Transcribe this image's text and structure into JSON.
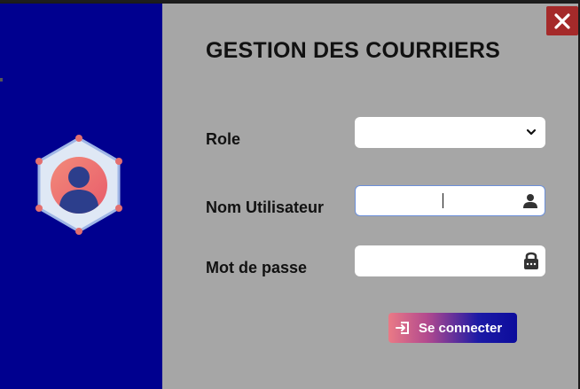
{
  "app": {
    "title": "GESTION DES COURRIERS"
  },
  "form": {
    "role_label": "Role",
    "role_value": "",
    "username_label": "Nom Utilisateur",
    "username_value": "",
    "password_label": "Mot de passe",
    "password_value": ""
  },
  "buttons": {
    "connect_label": "Se connecter"
  },
  "icons": {
    "close": "close-icon",
    "dropdown": "chevron-down-icon",
    "user": "user-icon",
    "lock": "lock-icon",
    "login": "login-icon",
    "avatar": "user-avatar-icon"
  },
  "colors": {
    "left_panel": "#00008f",
    "right_panel": "#a6a6a6",
    "close_button": "#a52a2a",
    "button_gradient_start": "#ea7a86",
    "button_gradient_end": "#0c0c9c"
  }
}
